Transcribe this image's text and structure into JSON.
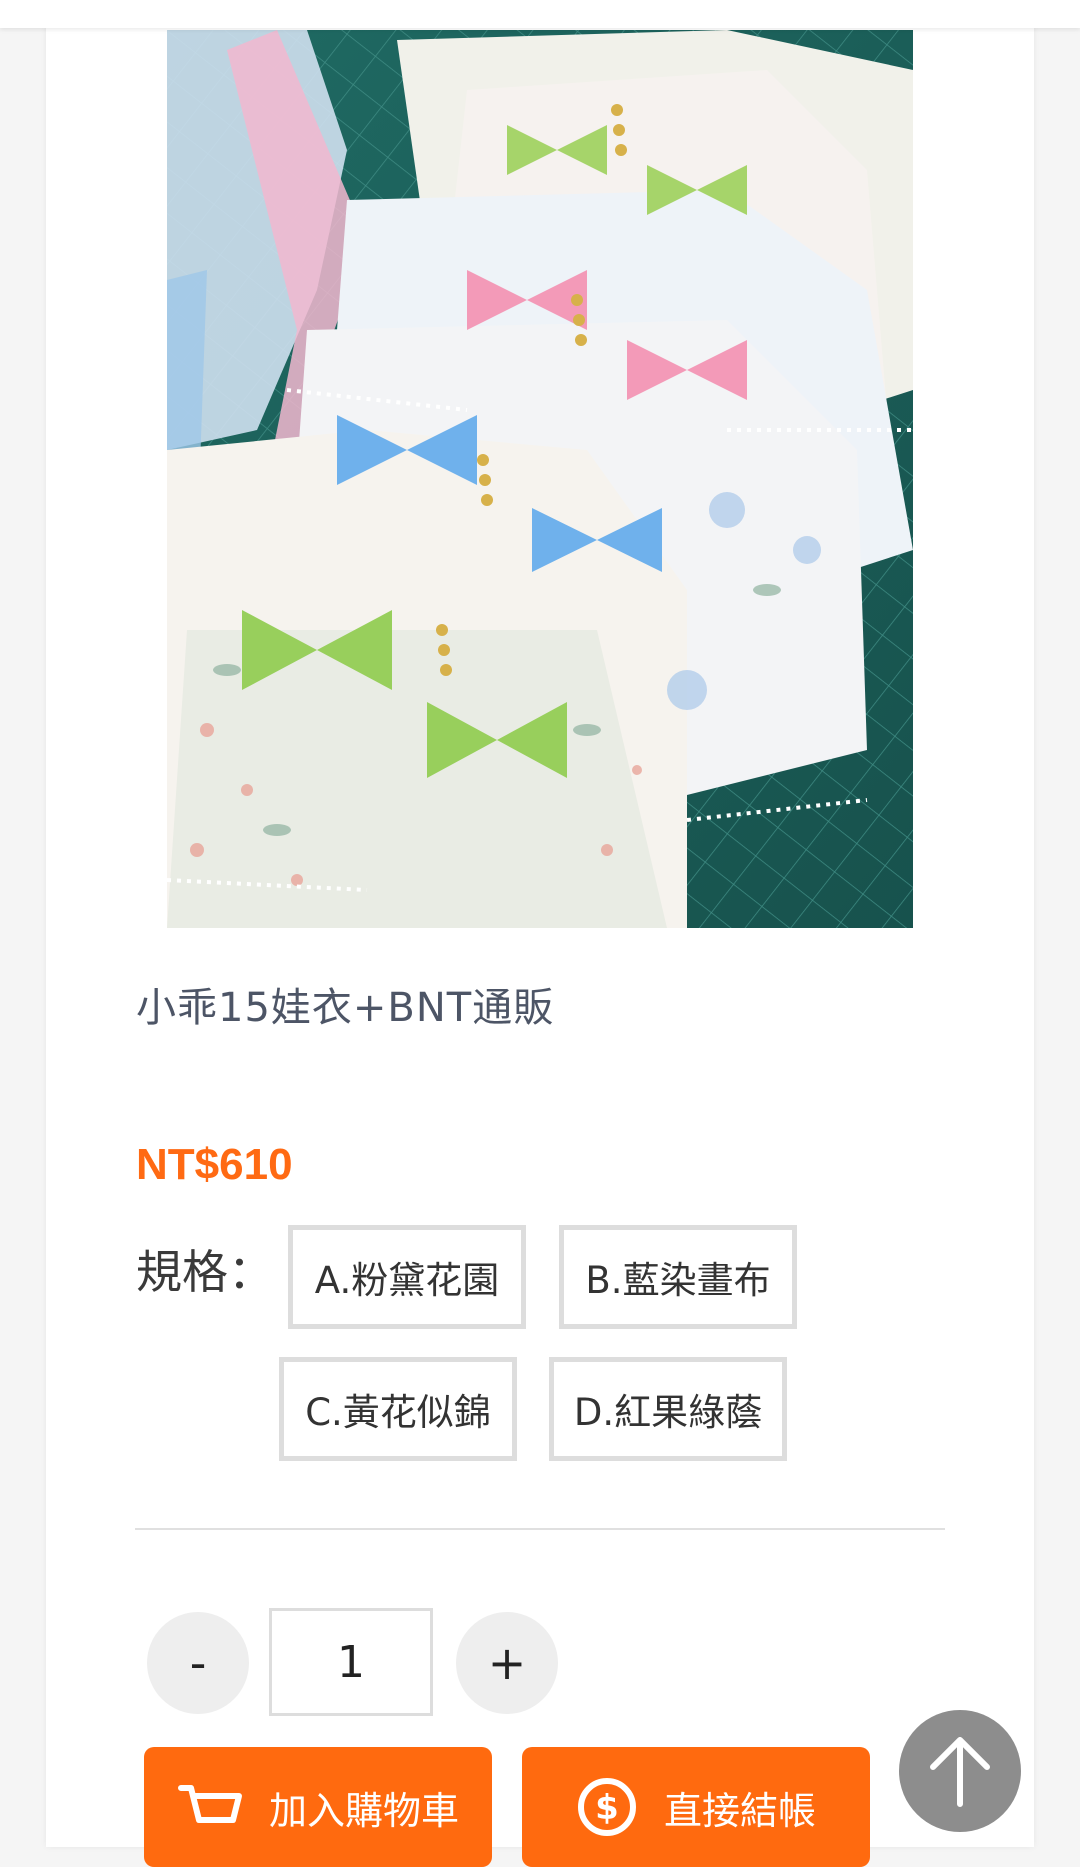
{
  "product": {
    "title": "小乖15娃衣+BNT通販",
    "price": "NT$610"
  },
  "spec": {
    "label": "規格：",
    "options": [
      "A.粉黛花園",
      "B.藍染畫布",
      "C.黃花似錦",
      "D.紅果綠蔭"
    ]
  },
  "quantity": {
    "minus": "-",
    "value": "1",
    "plus": "+"
  },
  "actions": {
    "add_to_cart": "加入購物車",
    "checkout": "直接結帳"
  },
  "icons": {
    "cart": "cart-icon",
    "dollar": "dollar-circle-icon",
    "back_to_top": "arrow-up-icon"
  },
  "colors": {
    "accent": "#ff6a0f",
    "price": "#ff6a13"
  }
}
